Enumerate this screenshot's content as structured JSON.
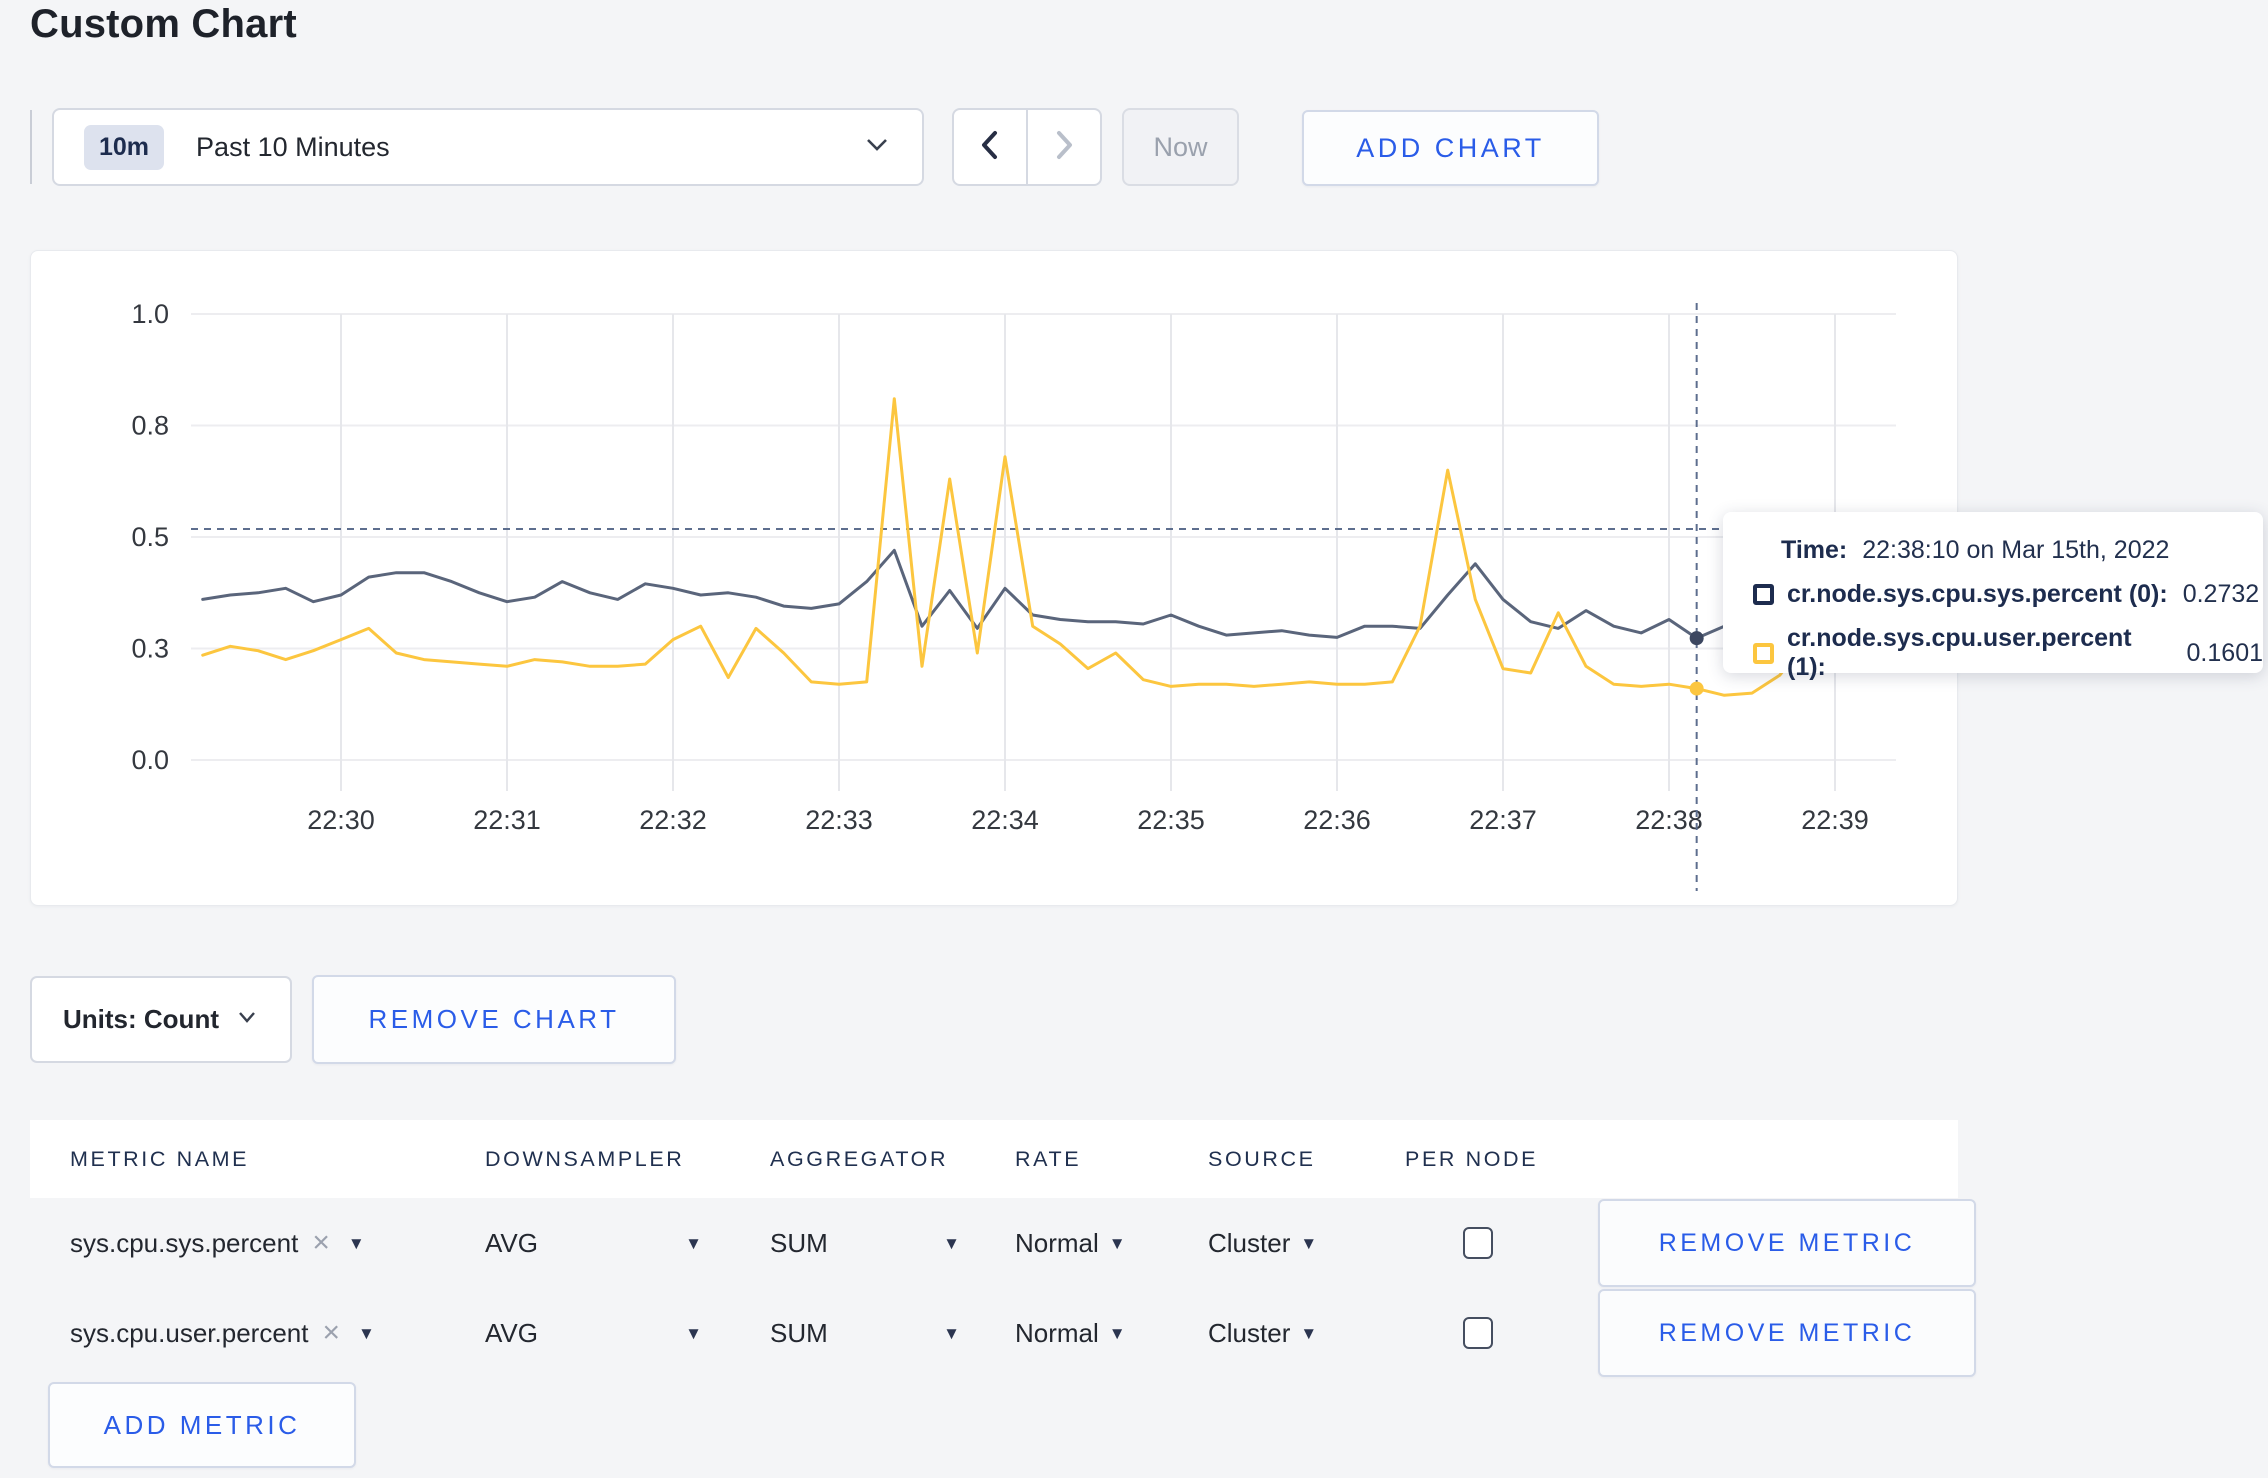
{
  "page": {
    "title": "Custom Chart"
  },
  "theme": {
    "accent_blue": "#2a5ce8",
    "navy": "#1d2c4e",
    "series_sys_color": "#5a657b",
    "series_user_color": "#fcc63f",
    "page_background": "#f4f5f7"
  },
  "toolbar": {
    "time_badge": "10m",
    "time_label": "Past 10 Minutes",
    "now_label": "Now",
    "add_chart_label": "ADD CHART"
  },
  "chart_data": {
    "type": "line",
    "x_start": "22:29:10",
    "x_step_seconds": 10,
    "x_tick_labels": [
      "22:30",
      "22:31",
      "22:32",
      "22:33",
      "22:34",
      "22:35",
      "22:36",
      "22:37",
      "22:38",
      "22:39"
    ],
    "y_tick_labels": [
      "0.0",
      "0.3",
      "0.5",
      "0.8",
      "1.0"
    ],
    "y_tick_positions": [
      0,
      0.25,
      0.5,
      0.75,
      1.0
    ],
    "ylim": [
      0,
      1
    ],
    "grid": true,
    "legend_position": "none",
    "series": [
      {
        "name": "cr.node.sys.cpu.sys.percent",
        "color": "#5a657b",
        "values": [
          0.36,
          0.37,
          0.375,
          0.385,
          0.355,
          0.37,
          0.41,
          0.42,
          0.42,
          0.4,
          0.375,
          0.355,
          0.365,
          0.4,
          0.375,
          0.36,
          0.395,
          0.385,
          0.37,
          0.375,
          0.365,
          0.345,
          0.34,
          0.35,
          0.4,
          0.47,
          0.3,
          0.38,
          0.295,
          0.385,
          0.325,
          0.315,
          0.31,
          0.31,
          0.305,
          0.325,
          0.3,
          0.28,
          0.285,
          0.29,
          0.28,
          0.275,
          0.3,
          0.3,
          0.295,
          0.37,
          0.44,
          0.36,
          0.31,
          0.295,
          0.335,
          0.3,
          0.285,
          0.315,
          0.2732,
          0.3,
          0.31,
          0.3,
          0.315,
          0.31,
          0.3,
          0.305
        ]
      },
      {
        "name": "cr.node.sys.cpu.user.percent",
        "color": "#fcc63f",
        "values": [
          0.235,
          0.255,
          0.245,
          0.225,
          0.245,
          0.27,
          0.295,
          0.24,
          0.225,
          0.22,
          0.215,
          0.21,
          0.225,
          0.22,
          0.21,
          0.21,
          0.215,
          0.27,
          0.3,
          0.185,
          0.295,
          0.24,
          0.175,
          0.17,
          0.175,
          0.81,
          0.21,
          0.63,
          0.24,
          0.68,
          0.3,
          0.26,
          0.205,
          0.24,
          0.18,
          0.165,
          0.17,
          0.17,
          0.165,
          0.17,
          0.175,
          0.17,
          0.17,
          0.175,
          0.3,
          0.65,
          0.36,
          0.205,
          0.195,
          0.33,
          0.21,
          0.17,
          0.165,
          0.17,
          0.1601,
          0.145,
          0.15,
          0.19,
          0.27,
          0.25,
          0.3,
          0.24
        ]
      }
    ],
    "crosshair": {
      "time": "22:38:10",
      "x_index": 54,
      "y_value": 0.518,
      "points": [
        0.2732,
        0.1601
      ]
    }
  },
  "tooltip": {
    "time_label": "Time:",
    "time_value": "22:38:10 on Mar 15th, 2022",
    "series": [
      {
        "label": "cr.node.sys.cpu.sys.percent (0):",
        "value": "0.2732",
        "color": "#1d2c4e"
      },
      {
        "label": "cr.node.sys.cpu.user.percent (1):",
        "value": "0.1601",
        "color": "#fcc63f"
      }
    ]
  },
  "chart_footer": {
    "units_label": "Units: Count",
    "remove_chart_label": "REMOVE CHART"
  },
  "metrics_table": {
    "headers": [
      "METRIC NAME",
      "DOWNSAMPLER",
      "AGGREGATOR",
      "RATE",
      "SOURCE",
      "PER NODE"
    ],
    "rows": [
      {
        "metric": "sys.cpu.sys.percent",
        "clear": "×",
        "downsampler": "AVG",
        "aggregator": "SUM",
        "rate": "Normal",
        "source": "Cluster",
        "per_node_checked": false,
        "remove_label": "REMOVE METRIC"
      },
      {
        "metric": "sys.cpu.user.percent",
        "clear": "×",
        "downsampler": "AVG",
        "aggregator": "SUM",
        "rate": "Normal",
        "source": "Cluster",
        "per_node_checked": false,
        "remove_label": "REMOVE METRIC"
      }
    ],
    "add_metric_label": "ADD METRIC"
  }
}
